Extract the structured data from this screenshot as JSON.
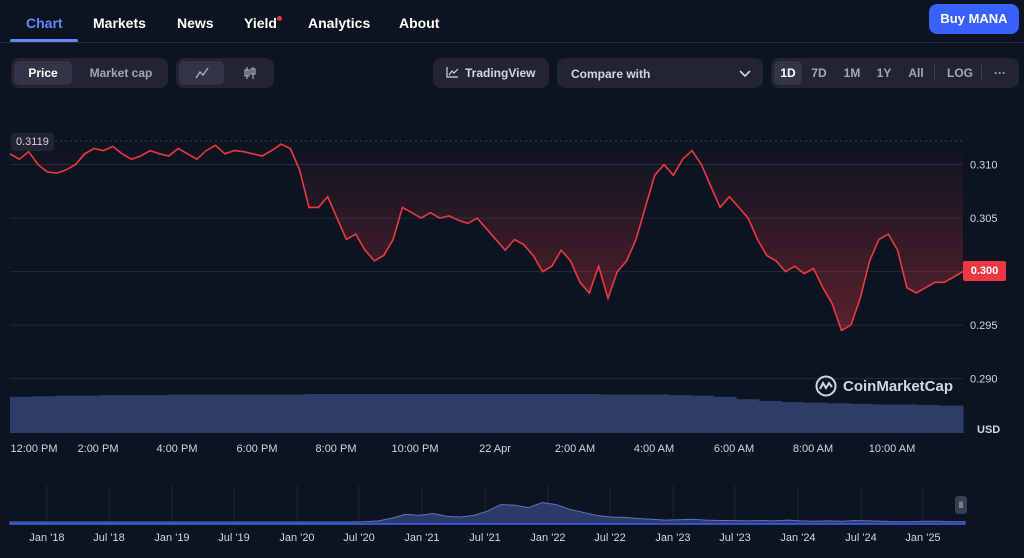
{
  "nav": {
    "tabs": [
      {
        "label": "Chart",
        "active": true
      },
      {
        "label": "Markets"
      },
      {
        "label": "News"
      },
      {
        "label": "Yield"
      },
      {
        "label": "Analytics"
      },
      {
        "label": "About"
      }
    ],
    "buy_label": "Buy MANA"
  },
  "toolbar": {
    "price_label": "Price",
    "marketcap_label": "Market cap",
    "tradingview_label": "TradingView",
    "compare_label": "Compare with",
    "ranges": [
      "1D",
      "7D",
      "1M",
      "1Y",
      "All"
    ],
    "active_range": "1D",
    "log_label": "LOG",
    "more_label": "···"
  },
  "chart": {
    "high_label": "0.3119",
    "current_price": "0.300",
    "currency": "USD",
    "watermark": "CoinMarketCap"
  },
  "colors": {
    "background": "#0d1421",
    "line": "#ea3943",
    "accent": "#6188ff",
    "buy_button": "#3861fb",
    "volume": "#3a4a7a"
  },
  "chart_data": [
    {
      "type": "line",
      "series": [
        {
          "name": "",
          "values": [
            0.311,
            0.3105,
            0.3112,
            0.31,
            0.3093,
            0.3092,
            0.3095,
            0.31,
            0.311,
            0.3115,
            0.3113,
            0.3117,
            0.311,
            0.3105,
            0.3108,
            0.3113,
            0.311,
            0.3108,
            0.3115,
            0.311,
            0.3105,
            0.3113,
            0.3118,
            0.311,
            0.3113,
            0.3112,
            0.311,
            0.3108,
            0.3113,
            0.3119,
            0.3115,
            0.3095,
            0.306,
            0.306,
            0.307,
            0.305,
            0.303,
            0.3035,
            0.302,
            0.301,
            0.3015,
            0.303,
            0.306,
            0.3055,
            0.305,
            0.3055,
            0.305,
            0.3052,
            0.3048,
            0.3045,
            0.305,
            0.304,
            0.303,
            0.302,
            0.303,
            0.3025,
            0.3015,
            0.3,
            0.3005,
            0.302,
            0.301,
            0.299,
            0.298,
            0.3005,
            0.2975,
            0.3,
            0.301,
            0.303,
            0.306,
            0.309,
            0.31,
            0.309,
            0.3105,
            0.3113,
            0.31,
            0.308,
            0.306,
            0.307,
            0.306,
            0.305,
            0.303,
            0.3015,
            0.301,
            0.3,
            0.3005,
            0.2998,
            0.3003,
            0.2985,
            0.297,
            0.2945,
            0.295,
            0.2975,
            0.301,
            0.303,
            0.3035,
            0.302,
            0.2985,
            0.298,
            0.2985,
            0.299,
            0.299,
            0.2995,
            0.3
          ]
        }
      ],
      "x_ticks": [
        "12:00 PM",
        "2:00 PM",
        "4:00 PM",
        "6:00 PM",
        "8:00 PM",
        "10:00 PM",
        "22 Apr",
        "2:00 AM",
        "4:00 AM",
        "6:00 AM",
        "8:00 AM",
        "10:00 AM"
      ],
      "y_ticks": [
        "0.310",
        "0.305",
        "0.300",
        "0.295",
        "0.290"
      ],
      "ylim": [
        0.2895,
        0.3122
      ],
      "ylabel": "USD",
      "volume": [
        0.62,
        0.63,
        0.64,
        0.64,
        0.65,
        0.65,
        0.65,
        0.66,
        0.66,
        0.66,
        0.66,
        0.66,
        0.66,
        0.67,
        0.67,
        0.67,
        0.67,
        0.67,
        0.67,
        0.67,
        0.67,
        0.67,
        0.67,
        0.67,
        0.67,
        0.67,
        0.66,
        0.66,
        0.66,
        0.65,
        0.64,
        0.62,
        0.58,
        0.55,
        0.53,
        0.52,
        0.51,
        0.5,
        0.49,
        0.49,
        0.48,
        0.47
      ],
      "grid": true
    },
    {
      "type": "area",
      "x_ticks": [
        "Jan '18",
        "Jul '18",
        "Jan '19",
        "Jul '19",
        "Jan '20",
        "Jul '20",
        "Jan '21",
        "Jul '21",
        "Jan '22",
        "Jul '22",
        "Jan '23",
        "Jul '23",
        "Jan '24",
        "Jul '24",
        "Jan '25"
      ],
      "values": [
        0.05,
        0.05,
        0.05,
        0.05,
        0.05,
        0.05,
        0.05,
        0.05,
        0.05,
        0.05,
        0.05,
        0.05,
        0.05,
        0.05,
        0.05,
        0.05,
        0.05,
        0.05,
        0.05,
        0.05,
        0.05,
        0.05,
        0.05,
        0.05,
        0.05,
        0.05,
        0.06,
        0.08,
        0.15,
        0.25,
        0.22,
        0.27,
        0.2,
        0.18,
        0.22,
        0.33,
        0.5,
        0.48,
        0.42,
        0.55,
        0.5,
        0.38,
        0.3,
        0.22,
        0.18,
        0.17,
        0.14,
        0.12,
        0.1,
        0.11,
        0.12,
        0.1,
        0.09,
        0.09,
        0.08,
        0.09,
        0.08,
        0.1,
        0.08,
        0.07,
        0.08,
        0.07,
        0.09,
        0.08,
        0.07,
        0.06,
        0.06,
        0.07,
        0.07,
        0.06,
        0.06
      ]
    }
  ]
}
